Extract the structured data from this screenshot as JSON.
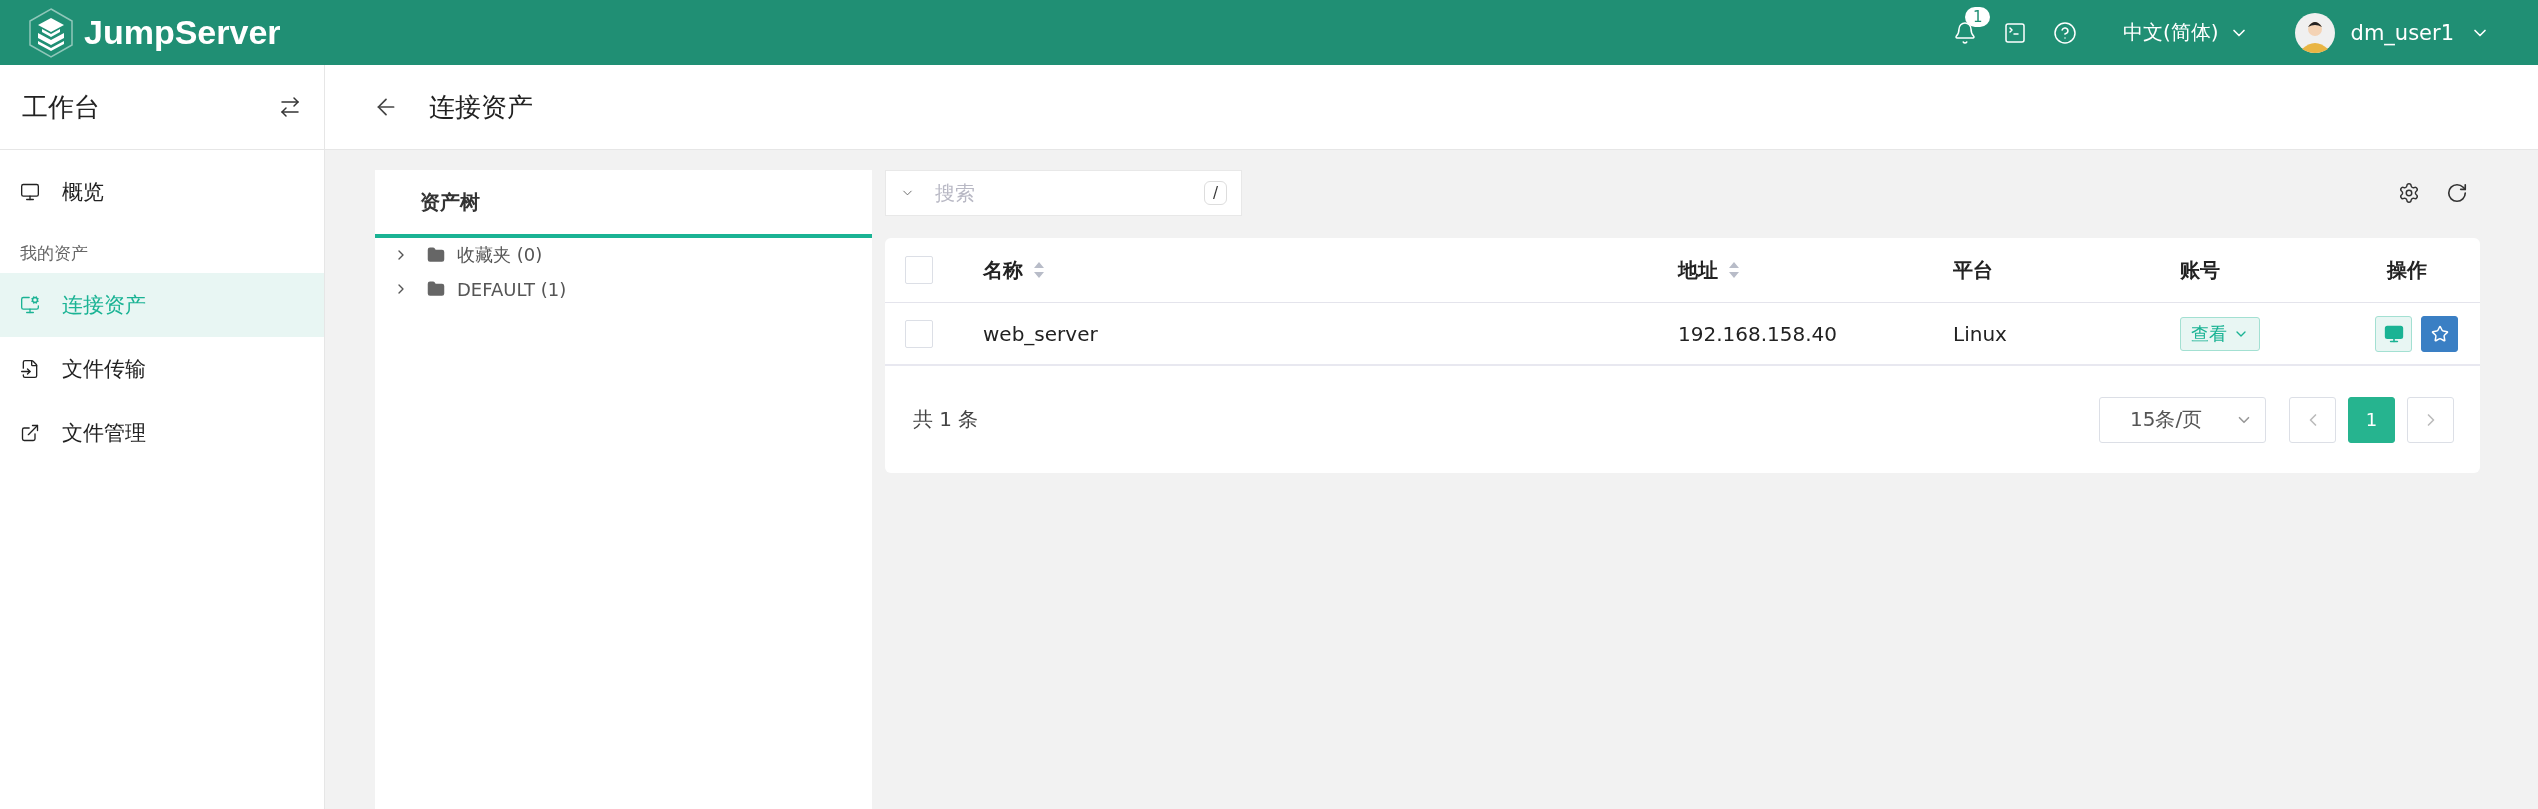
{
  "topbar": {
    "logo": "JumpServer",
    "notifications": {
      "count": "1"
    },
    "language": "中文(简体)",
    "user": "dm_user1"
  },
  "sidebar": {
    "title": "工作台",
    "items": [
      {
        "kind": "item",
        "label": "概览",
        "selected": false
      },
      {
        "kind": "section",
        "label": "我的资产"
      },
      {
        "kind": "item",
        "label": "连接资产",
        "selected": true
      },
      {
        "kind": "item",
        "label": "文件传输",
        "selected": false
      },
      {
        "kind": "item",
        "label": "文件管理",
        "selected": false
      }
    ]
  },
  "page": {
    "title": "连接资产"
  },
  "tree": {
    "tab": "资产树",
    "nodes": [
      {
        "label": "收藏夹 (0)",
        "expanded": false
      },
      {
        "label": "DEFAULT (1)",
        "expanded": false
      }
    ]
  },
  "search": {
    "placeholder": "搜索",
    "shortcut": "/"
  },
  "table": {
    "select_all_checked": false,
    "columns": [
      {
        "label": "名称",
        "sortable": true
      },
      {
        "label": "地址",
        "sortable": true
      },
      {
        "label": "平台",
        "sortable": false
      },
      {
        "label": "账号",
        "sortable": false
      },
      {
        "label": "操作",
        "sortable": false
      }
    ],
    "rows": [
      {
        "checked": false,
        "cells": [
          "web_server",
          "192.168.158.40",
          "Linux"
        ],
        "account_button": "查看"
      }
    ]
  },
  "footer": {
    "total": "共 1 条",
    "page_size": "15条/页",
    "pages": [
      {
        "label": "1",
        "selected": true
      }
    ]
  }
}
